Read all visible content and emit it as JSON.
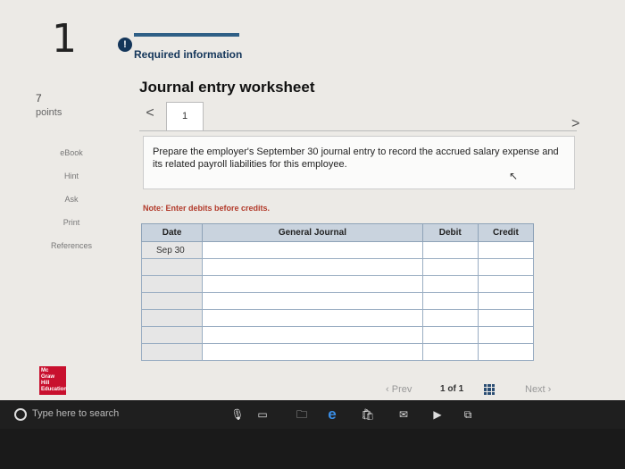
{
  "question_number": "1",
  "header": {
    "required_info": "Required information",
    "info_icon": "!"
  },
  "points": {
    "value": "7",
    "label": "points"
  },
  "sidebar": {
    "items": [
      "eBook",
      "Hint",
      "Ask",
      "Print",
      "References"
    ]
  },
  "worksheet": {
    "title": "Journal entry worksheet",
    "prev_arrow": "<",
    "next_arrow": ">",
    "tab_label": "1",
    "instruction": "Prepare the employer's September 30 journal entry to record the accrued salary expense and its related payroll liabilities for this employee.",
    "note": "Note: Enter debits before credits."
  },
  "journal": {
    "headers": [
      "Date",
      "General Journal",
      "Debit",
      "Credit"
    ],
    "rows": [
      {
        "date": "Sep 30"
      },
      {
        "date": ""
      },
      {
        "date": ""
      },
      {
        "date": ""
      },
      {
        "date": ""
      },
      {
        "date": ""
      },
      {
        "date": ""
      }
    ]
  },
  "logo": {
    "line1": "Mc",
    "line2": "Graw",
    "line3": "Hill",
    "line4": "Education"
  },
  "pager": {
    "prev": "Prev",
    "current": "1",
    "of": "of",
    "total": "1",
    "next": "Next"
  },
  "taskbar": {
    "search_placeholder": "Type here to search"
  },
  "colors": {
    "header_bg": "#c9d3de",
    "brand_red": "#c8102e",
    "note_red": "#b23a2a",
    "accent_blue": "#2f5f86"
  }
}
